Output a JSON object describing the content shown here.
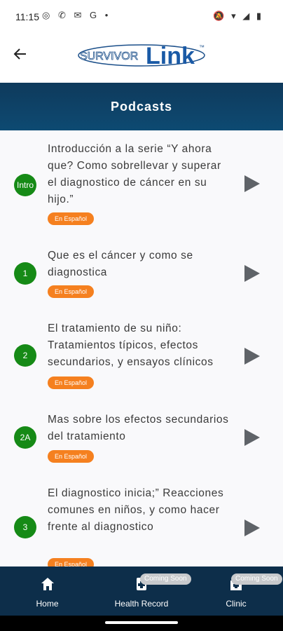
{
  "status": {
    "time": "11:15",
    "left_icons": "◎ ✆ ✉ G •",
    "right_icons": "🔕 ▾ ◢ ▮"
  },
  "appbar": {
    "back_icon": "arrow-left-icon",
    "logo_text_a": "SURVIVOR",
    "logo_text_b": "Link",
    "logo_tm": "™"
  },
  "header": {
    "title": "Podcasts"
  },
  "badge_label": "En Español",
  "podcasts": [
    {
      "num": "Intro",
      "title": "Introducción a la serie “Y ahora que? Como sobrellevar y superar el diagnostico de cáncer en su hijo.”",
      "badge": "En Español"
    },
    {
      "num": "1",
      "title": "Que es el cáncer y como se diagnostica",
      "badge": "En Español"
    },
    {
      "num": "2",
      "title": "El tratamiento de su niño: Tratamientos típicos, efectos secundarios, y ensayos clínicos",
      "badge": "En Español"
    },
    {
      "num": "2A",
      "title": "Mas sobre los efectos secundarios del tratamiento",
      "badge": "En Español"
    },
    {
      "num": "3",
      "title": "El diagnostico inicia;” Reacciones comunes en niños, y como hacer frente al diagnostico",
      "badge": "En Español"
    }
  ],
  "nav": {
    "home": "Home",
    "health_record": "Health Record",
    "clinic": "Clinic",
    "coming_soon": "Coming Soon"
  },
  "colors": {
    "header": "#0d4a72",
    "nav_bg": "#0d2e4a",
    "num_circle": "#168a16",
    "badge": "#f5801f"
  }
}
